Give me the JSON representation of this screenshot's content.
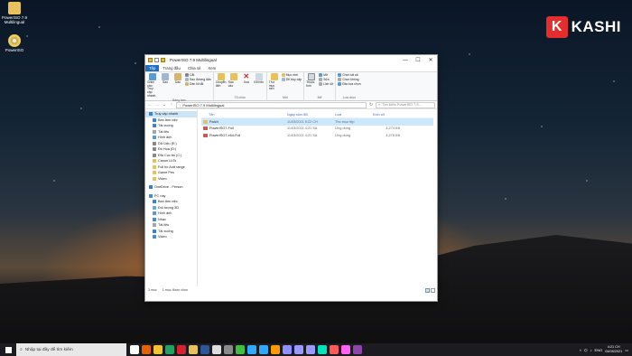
{
  "desktop": {
    "icons": [
      {
        "label": "PowerISO 7.9 Multilingual",
        "icon": "folder-icon"
      },
      {
        "label": "PowerISO",
        "icon": "poweriso-disc-icon"
      }
    ],
    "brand": {
      "letter": "K",
      "name": "KASHI",
      "color": "#e52d2d"
    }
  },
  "window": {
    "title": "PowerISO 7.9 Multilingual",
    "tabs": [
      "Tệp",
      "Trang đầu",
      "Chia sẻ",
      "Xem"
    ],
    "ribbon": {
      "clipboard": {
        "pin_label": "Ghim vào Truy cập nhanh",
        "copy_label": "Sao",
        "paste_label": "Dán",
        "cut_label": "Cắt",
        "copy_path_label": "Sao đường dẫn",
        "paste_shortcut_label": "Dán lối tắt",
        "group_label": "Bảng tạm"
      },
      "organize": {
        "move_label": "Chuyển đến",
        "copy_to_label": "Sao vào",
        "delete_label": "Xoá",
        "rename_label": "Đổi tên",
        "group_label": "Tổ chức"
      },
      "new": {
        "new_folder_label": "Thư mục mới",
        "new_item_label": "Mục mới",
        "easy_access_label": "Dễ truy cập",
        "group_label": "Mới"
      },
      "open": {
        "properties_label": "Thuộc tính",
        "open_label": "Mở",
        "edit_label": "Sửa",
        "history_label": "Lịch sử",
        "group_label": "Mở"
      },
      "select": {
        "select_all_label": "Chọn tất cả",
        "select_none_label": "Chọn không",
        "invert_label": "Đảo lựa chọn",
        "group_label": "Lựa chọn"
      }
    },
    "address": {
      "path": "PowerISO 7.9 Multilingual",
      "search_placeholder": "Tìm kiếm PowerISO 7.9..."
    },
    "nav": [
      {
        "label": "Truy cập nhanh",
        "selected": true,
        "sub": false,
        "color": "#3b82d6"
      },
      {
        "label": "Bàn làm việc",
        "selected": false,
        "sub": true,
        "color": "#3b82d6"
      },
      {
        "label": "Tải xuống",
        "selected": false,
        "sub": true,
        "color": "#3b82d6"
      },
      {
        "label": "Tài liệu",
        "selected": false,
        "sub": true,
        "color": "#9aa6b8"
      },
      {
        "label": "Hình ảnh",
        "selected": false,
        "sub": true,
        "color": "#5b9bd5"
      },
      {
        "label": "Dữ Liệu (E:)",
        "selected": false,
        "sub": true,
        "color": "#888888"
      },
      {
        "label": "Đồ Họa (D:)",
        "selected": false,
        "sub": true,
        "color": "#888888"
      },
      {
        "label": "Đĩa Cục bộ (C:)",
        "selected": false,
        "sub": true,
        "color": "#888888"
      },
      {
        "label": "Canon LbTs",
        "selected": false,
        "sub": true,
        "color": "#e8c15a"
      },
      {
        "label": "Full bo Autt range",
        "selected": false,
        "sub": true,
        "color": "#e8c15a"
      },
      {
        "label": "Game Pes",
        "selected": false,
        "sub": true,
        "color": "#e8c15a"
      },
      {
        "label": "Video",
        "selected": false,
        "sub": true,
        "color": "#e8c15a"
      },
      {
        "label": "",
        "selected": false,
        "sub": false,
        "color": ""
      },
      {
        "label": "OneDrive - Person",
        "selected": false,
        "sub": false,
        "color": "#2f7bd8"
      },
      {
        "label": "",
        "selected": false,
        "sub": false,
        "color": ""
      },
      {
        "label": "PC này",
        "selected": false,
        "sub": false,
        "color": "#4a8ad4"
      },
      {
        "label": "Bàn làm việc",
        "selected": false,
        "sub": true,
        "color": "#3b82d6"
      },
      {
        "label": "Đối tượng 3D",
        "selected": false,
        "sub": true,
        "color": "#6aa7e0"
      },
      {
        "label": "Hình ảnh",
        "selected": false,
        "sub": true,
        "color": "#5b9bd5"
      },
      {
        "label": "Nhạc",
        "selected": false,
        "sub": true,
        "color": "#4a8ad4"
      },
      {
        "label": "Tài liệu",
        "selected": false,
        "sub": true,
        "color": "#9aa6b8"
      },
      {
        "label": "Tải xuống",
        "selected": false,
        "sub": true,
        "color": "#3b82d6"
      },
      {
        "label": "Video",
        "selected": false,
        "sub": true,
        "color": "#4a8ad4"
      }
    ],
    "columns": {
      "name": "Tên",
      "date": "Ngày sửa đổi",
      "type": "Loại",
      "size": "Kích cỡ"
    },
    "files": [
      {
        "name": "Patch",
        "date": "11/03/2021 5:22 CH",
        "type": "Thư mục tệp",
        "size": "",
        "selected": true,
        "icon": "folder-icon",
        "color": "#e8c15a"
      },
      {
        "name": "PowerISO7-Full",
        "date": "11/03/2021 4:21 SA",
        "type": "Ứng dụng",
        "size": "4.274 KB",
        "selected": false,
        "icon": "app-icon",
        "color": "#d9534f"
      },
      {
        "name": "PowerISO7-x64-Full",
        "date": "11/03/2021 4:21 SA",
        "type": "Ứng dụng",
        "size": "4.278 KB",
        "selected": false,
        "icon": "app-icon",
        "color": "#d9534f"
      }
    ],
    "status": {
      "count": "3 mục",
      "selection": "1 mục được chọn"
    }
  },
  "taskbar": {
    "search_placeholder": "Nhập tại đây để tìm kiếm",
    "apps": [
      {
        "name": "task-view-icon",
        "color": "#ffffff"
      },
      {
        "name": "firefox-icon",
        "color": "#e66000"
      },
      {
        "name": "chrome-icon",
        "color": "#f2c230"
      },
      {
        "name": "edge-icon",
        "color": "#1fa363"
      },
      {
        "name": "opera-icon",
        "color": "#d6222d"
      },
      {
        "name": "file-explorer-icon",
        "color": "#e8c15a"
      },
      {
        "name": "word-icon",
        "color": "#2b579a"
      },
      {
        "name": "capcut-icon",
        "color": "#dddddd"
      },
      {
        "name": "game-icon",
        "color": "#8a8a8a"
      },
      {
        "name": "camtasia-icon",
        "color": "#3fbf3f"
      },
      {
        "name": "photoshop-icon",
        "color": "#31a8ff"
      },
      {
        "name": "lightroom-icon",
        "color": "#31a8ff"
      },
      {
        "name": "illustrator-icon",
        "color": "#ff9a00"
      },
      {
        "name": "media-encoder-icon",
        "color": "#8f8fff"
      },
      {
        "name": "premiere-icon",
        "color": "#9999ff"
      },
      {
        "name": "after-effects-icon",
        "color": "#9999ff"
      },
      {
        "name": "audition-icon",
        "color": "#00e4bb"
      },
      {
        "name": "animate-icon",
        "color": "#ff5a5a"
      },
      {
        "name": "xd-icon",
        "color": "#ff61f6"
      },
      {
        "name": "purple-app-icon",
        "color": "#8e44ad"
      }
    ],
    "tray": {
      "lang": "ENG",
      "time": "4:21 CH",
      "date": "04/05/2021"
    }
  }
}
